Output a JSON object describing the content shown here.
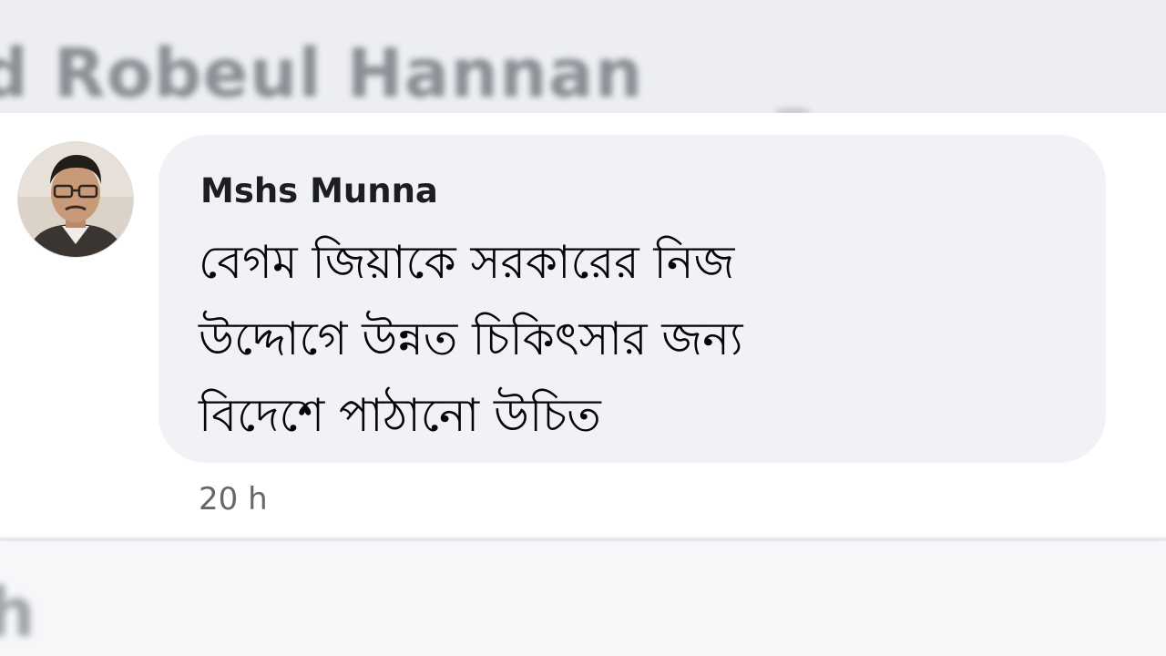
{
  "background_header": {
    "blurred_name": "d Robeul Hannan"
  },
  "comment": {
    "author": "Mshs Munna",
    "text_lines": [
      "বেগম জিয়াকে সরকারের নিজ",
      "উদ্দোগে উন্নত চিকিৎসার জন্য",
      "বিদেশে পাঠানো উচিত"
    ],
    "timestamp": "20 h",
    "avatar_icon": "profile-photo"
  },
  "background_footer": {
    "blurred_letter": "h"
  },
  "colors": {
    "bubble": "#f0f2f5",
    "author": "#1c1e21",
    "text": "#050505",
    "timestamp": "#65676b"
  }
}
